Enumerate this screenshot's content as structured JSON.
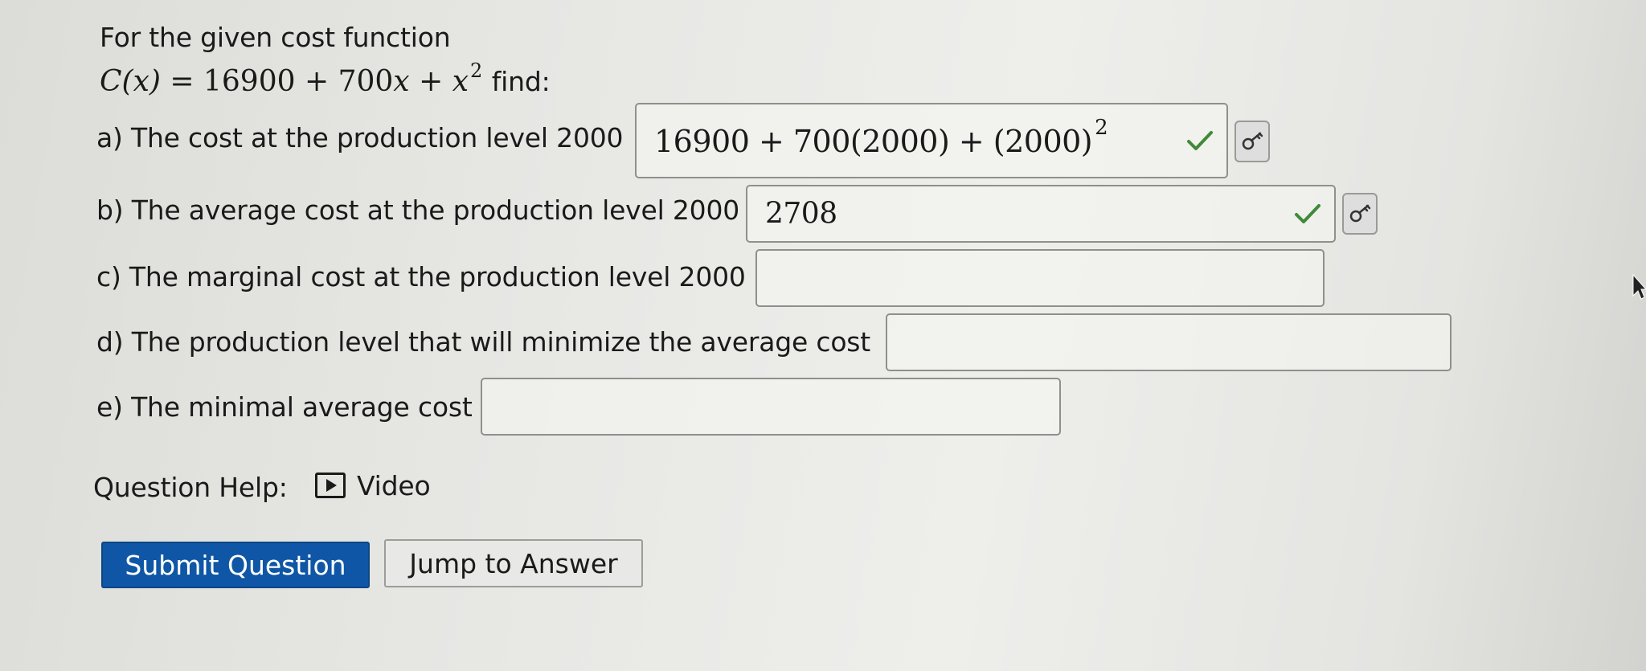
{
  "question": {
    "intro": "For the given cost function",
    "function_lhs": "C(x)",
    "function_rhs_1": "= 16900 + 700",
    "function_var": "x",
    "function_plus": "+",
    "function_var2": "x",
    "function_exp": "2",
    "function_suffix": "find:"
  },
  "parts": [
    {
      "label": "a) The cost at the production level 2000",
      "answer_base": "16900 + 700(2000) + (2000)",
      "answer_exp": "2",
      "correct": true
    },
    {
      "label": "b) The average cost at the production level 2000",
      "answer": "2708",
      "correct": true
    },
    {
      "label": "c) The marginal cost at the production level 2000",
      "answer": ""
    },
    {
      "label": "d) The production level that will minimize the average cost",
      "answer": ""
    },
    {
      "label": "e) The minimal average cost",
      "answer": ""
    }
  ],
  "help": {
    "label": "Question Help:",
    "video_label": "Video"
  },
  "buttons": {
    "submit": "Submit Question",
    "jump": "Jump to Answer"
  },
  "icons": {
    "correct": "check-icon",
    "key": "key-icon",
    "video": "play-video-icon",
    "check_color": "#2f7d32"
  }
}
